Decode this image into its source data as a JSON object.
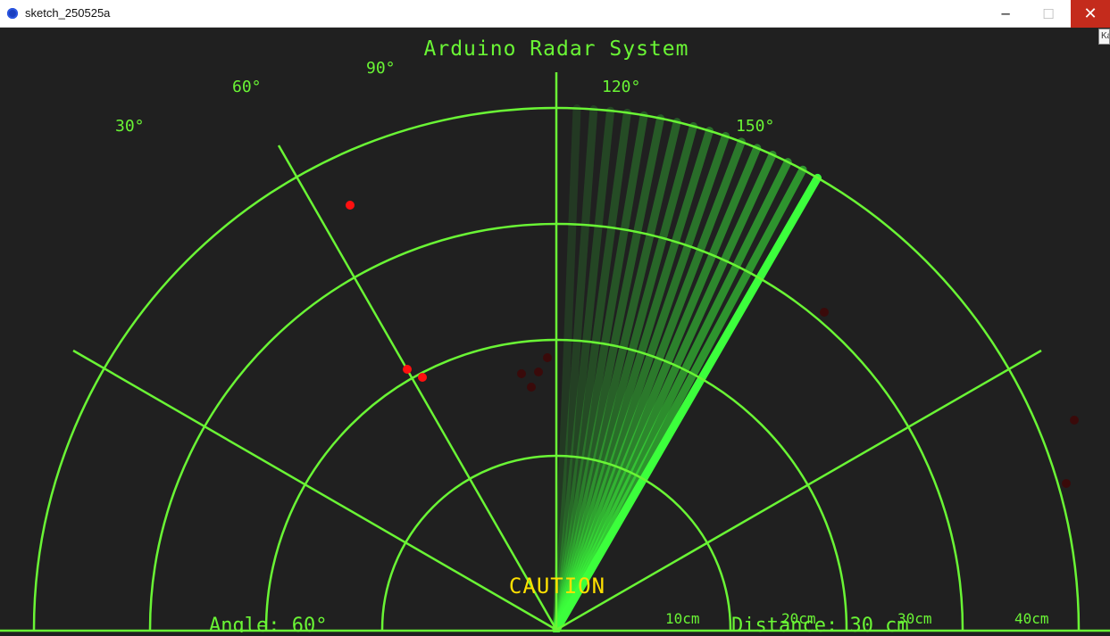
{
  "window": {
    "title": "sketch_250525a",
    "minimize": "─",
    "maximize": "☐",
    "close": "✕",
    "tooltip": "Ka"
  },
  "radar": {
    "title": "Arduino Radar System",
    "angle_labels": [
      "30°",
      "60°",
      "90°",
      "120°",
      "150°"
    ],
    "distance_labels": [
      "10cm",
      "20cm",
      "30cm",
      "40cm"
    ],
    "caution": "CAUTION",
    "angle_readout": "Angle: 60°",
    "distance_readout": "Distance: 30 cm",
    "colors": {
      "grid": "#6af535",
      "sweep": "#3cff3c",
      "title": "#6af535",
      "caution": "#ffe000",
      "object": "#ff1010",
      "object_faded": "#3a0a0a",
      "background": "#202020"
    },
    "sweep_angle_deg": 60,
    "sweep_trail_count": 16
  }
}
